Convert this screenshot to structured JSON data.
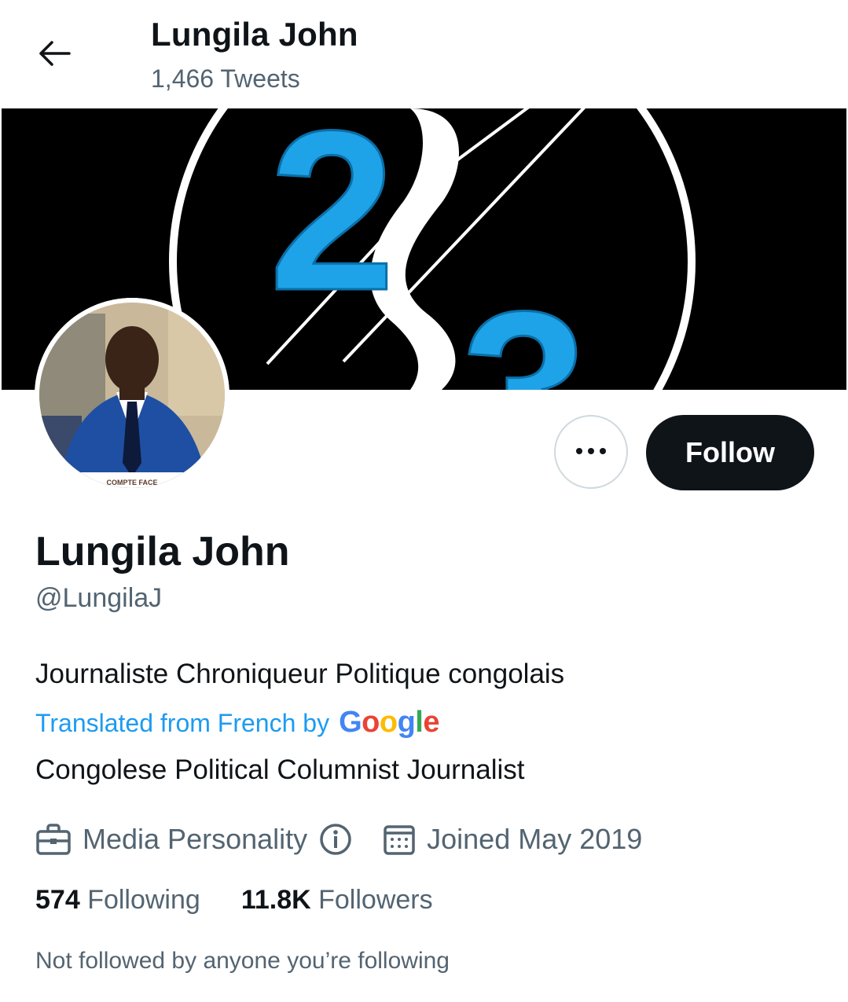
{
  "header": {
    "title": "Lungila John",
    "tweet_count": "1,466 Tweets"
  },
  "banner": {
    "text_left": "2",
    "text_right": "3",
    "colors": {
      "background": "#000000",
      "accent": "#1fa3e8",
      "ring": "#ffffff"
    }
  },
  "avatar": {
    "caption": "COMPTE FACE"
  },
  "actions": {
    "more_label": "•••",
    "follow_label": "Follow"
  },
  "profile": {
    "name": "Lungila John",
    "handle": "@LungilaJ",
    "bio": "Journaliste Chroniqueur Politique congolais",
    "translated_label": "Translated from French by",
    "google": [
      "G",
      "o",
      "o",
      "g",
      "l",
      "e"
    ],
    "bio_translated": "Congolese Political Columnist Journalist",
    "category": "Media Personality",
    "joined": "Joined May 2019",
    "following_count": "574",
    "following_label": "Following",
    "followers_count": "11.8K",
    "followers_label": "Followers",
    "not_followed": "Not followed by anyone you’re following"
  },
  "colors": {
    "text_primary": "#0f1419",
    "text_secondary": "#536471",
    "link": "#1d9bf0",
    "button_dark": "#0f1419"
  }
}
